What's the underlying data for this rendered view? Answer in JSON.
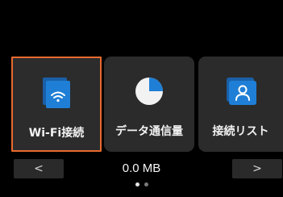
{
  "tiles": [
    {
      "label": "Wi-Fi接続",
      "icon": "wifi-icon",
      "selected": true
    },
    {
      "label": "データ通信量",
      "icon": "pie-chart-icon",
      "selected": false
    },
    {
      "label": "接続リスト",
      "icon": "user-list-icon",
      "selected": false
    }
  ],
  "footer": {
    "prev_label": "<",
    "next_label": ">",
    "data_usage": "0.0 MB"
  },
  "pagination": {
    "pages": 2,
    "current": 1
  },
  "colors": {
    "background": "#000000",
    "tile": "#2b2b2b",
    "selection_border": "#e86a2e",
    "icon_blue": "#1f7fd6",
    "text": "#f2f2f2"
  }
}
